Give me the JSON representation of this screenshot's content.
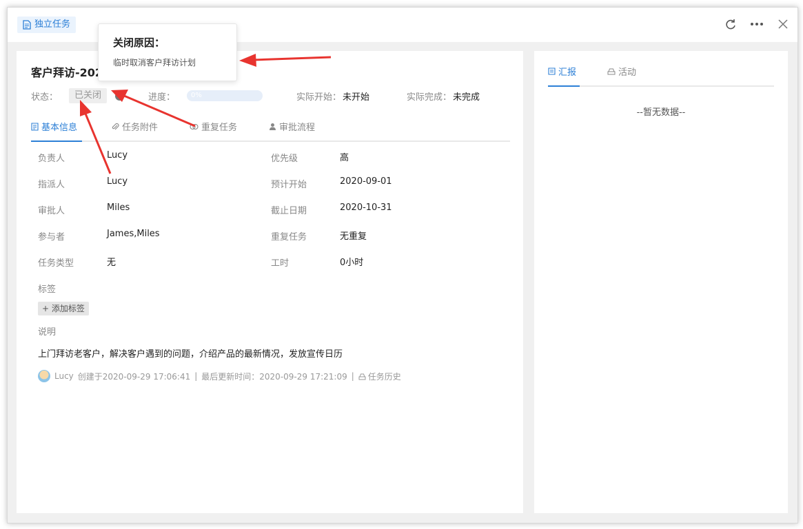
{
  "header": {
    "type_tag": "独立任务",
    "actions": {
      "refresh_icon": "refresh-icon",
      "more_icon": "more-icon",
      "close_icon": "close-icon"
    }
  },
  "task": {
    "title": "客户拜访-2020",
    "status_label": "状态：",
    "status_value": "已关闭",
    "progress_label": "进度：",
    "progress_text": "0%",
    "progress_value": 0,
    "actual_start_label": "实际开始：",
    "actual_start_value": "未开始",
    "actual_finish_label": "实际完成：",
    "actual_finish_value": "未完成"
  },
  "tabs": [
    {
      "label": "基本信息",
      "icon": "document-icon",
      "active": true
    },
    {
      "label": "任务附件",
      "icon": "paperclip-icon",
      "active": false
    },
    {
      "label": "重复任务",
      "icon": "repeat-icon",
      "active": false
    },
    {
      "label": "审批流程",
      "icon": "user-icon",
      "active": false
    }
  ],
  "fields": {
    "owner_label": "负责人",
    "owner_value": "Lucy",
    "priority_label": "优先级",
    "priority_value": "高",
    "assigner_label": "指派人",
    "assigner_value": "Lucy",
    "planned_start_label": "预计开始",
    "planned_start_value": "2020-09-01",
    "approver_label": "审批人",
    "approver_value": "Miles",
    "deadline_label": "截止日期",
    "deadline_value": "2020-10-31",
    "participants_label": "参与者",
    "participants_value": "James,Miles",
    "repeat_label": "重复任务",
    "repeat_value": "无重复",
    "task_type_label": "任务类型",
    "task_type_value": "无",
    "hours_label": "工时",
    "hours_value": "0小时"
  },
  "tags": {
    "label": "标签",
    "add_button": "+ 添加标签"
  },
  "description": {
    "label": "说明",
    "text": "上门拜访老客户，解决客户遇到的问题，介绍产品的最新情况，发放宣传日历"
  },
  "footer": {
    "user": "Lucy",
    "created": "创建于2020-09-29 17:06:41",
    "sep1": "|",
    "updated": "最后更新时间：2020-09-29 17:21:09",
    "sep2": "|",
    "history": "任务历史"
  },
  "right_panel": {
    "tabs": [
      {
        "label": "汇报",
        "icon": "report-icon",
        "active": true
      },
      {
        "label": "活动",
        "icon": "activity-icon",
        "active": false
      }
    ],
    "empty_text": "--暂无数据--"
  },
  "popover": {
    "title": "关闭原因：",
    "body": "临时取消客户拜访计划"
  },
  "colors": {
    "accent": "#2c7fd6",
    "annotation_arrow": "#e8342f"
  }
}
